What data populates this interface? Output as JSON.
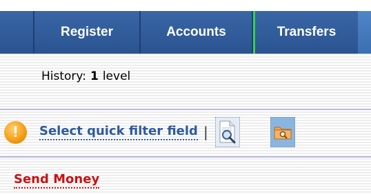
{
  "nav": {
    "tabs": [
      {
        "label": "Register"
      },
      {
        "label": "Accounts"
      },
      {
        "label": "Transfers",
        "active": true
      }
    ]
  },
  "history": {
    "prefix": "History:",
    "level_count": "1",
    "suffix": "level"
  },
  "filter": {
    "warning_glyph": "!",
    "link_label": "Select quick filter field",
    "separator": "|",
    "icons": [
      "magnifier-page-icon",
      "folder-search-icon"
    ]
  },
  "section": {
    "send_money_label": "Send Money"
  },
  "colors": {
    "nav_bg": "#2a5390",
    "active_tab_marker": "#35d14a",
    "link_blue": "#2c5aa0",
    "link_red": "#cc1111",
    "warning_orange": "#f39a10"
  }
}
